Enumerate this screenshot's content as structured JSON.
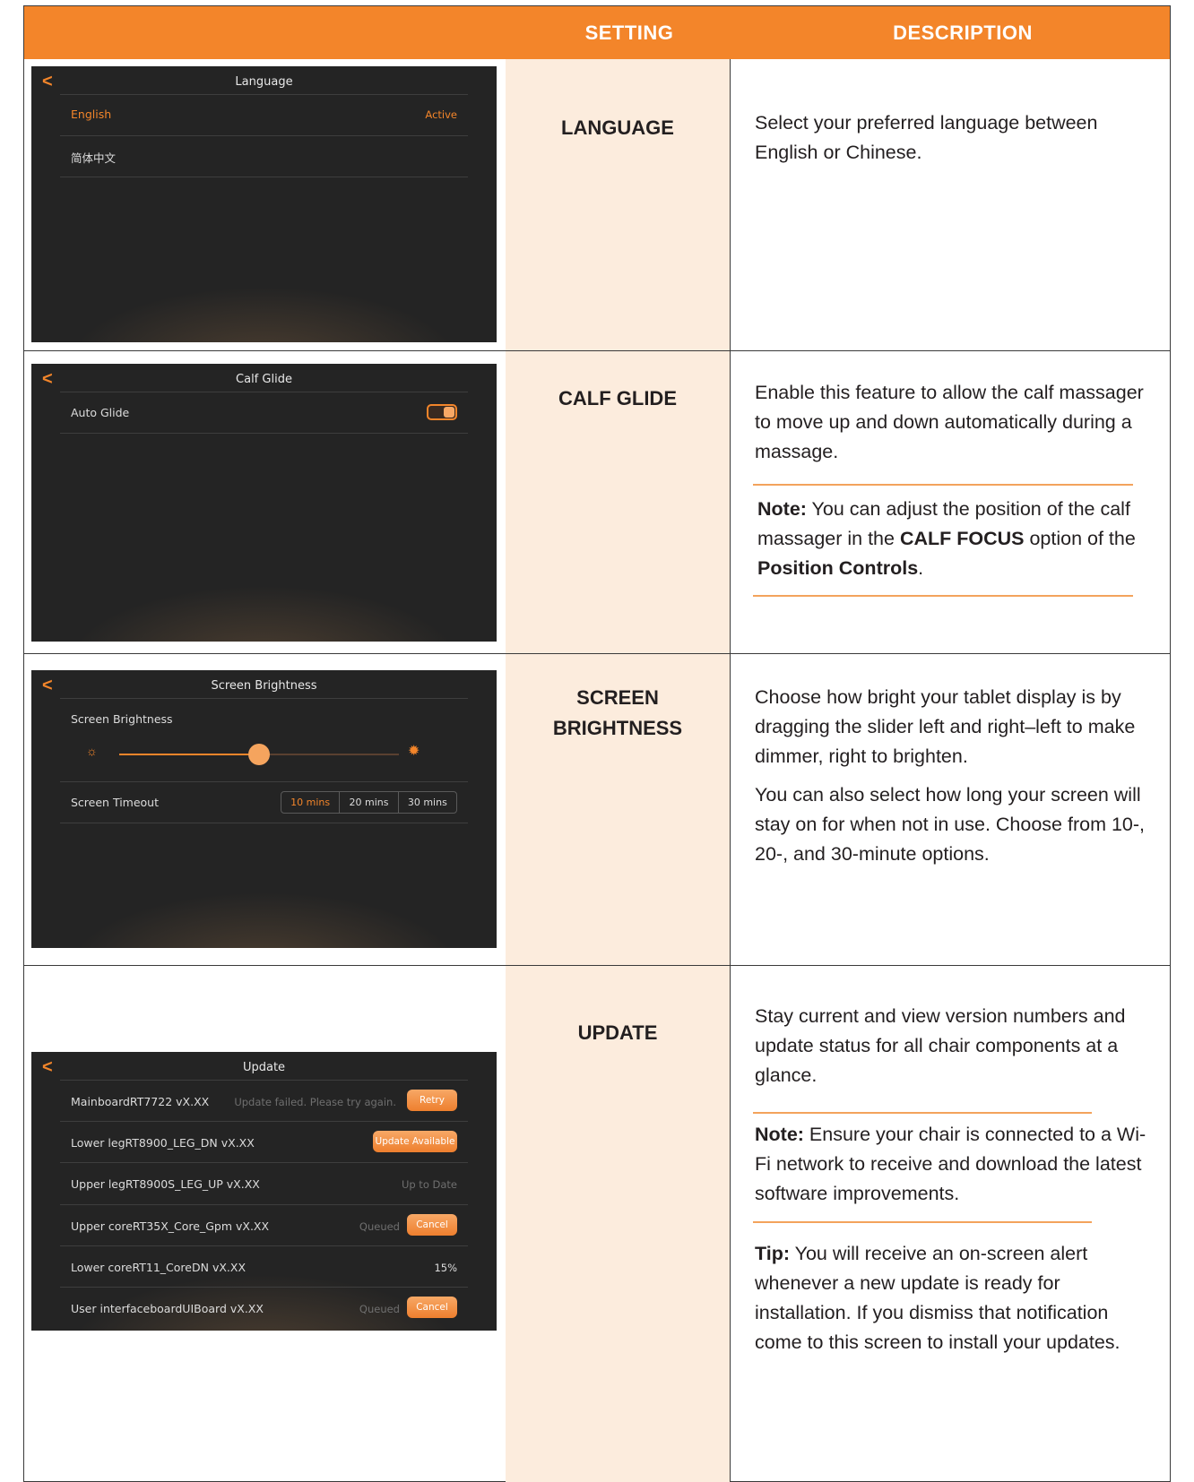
{
  "header": {
    "setting": "SETTING",
    "description": "DESCRIPTION"
  },
  "rows": {
    "language": {
      "setting": "LANGUAGE",
      "screen": {
        "title": "Language",
        "items": [
          {
            "label": "English",
            "status": "Active"
          },
          {
            "label": "简体中文"
          }
        ]
      },
      "desc": [
        "Select your preferred language between English or Chinese."
      ]
    },
    "calf": {
      "setting": "CALF GLIDE",
      "screen": {
        "title": "Calf Glide",
        "item": "Auto Glide",
        "toggle_on": true
      },
      "desc": [
        "Enable this feature to allow the calf massager to move up and down automatically during a massage."
      ],
      "note": {
        "label": "Note:",
        "t1": " You can adjust the position of the calf massager in the ",
        "b1": "CALF FOCUS",
        "t2": " option of the ",
        "b2": "Position Controls",
        "t3": "."
      }
    },
    "brightness": {
      "setting_line1": "SCREEN",
      "setting_line2": "BRIGHTNESS",
      "screen": {
        "title": "Screen Brightness",
        "brightness_label": "Screen Brightness",
        "brightness_level": 0.5,
        "timeout_label": "Screen Timeout",
        "options": [
          "10 mins",
          "20 mins",
          "30 mins"
        ],
        "selected": "10 mins"
      },
      "desc": [
        "Choose how bright your tablet display is by dragging the slider left and right–left to make dimmer, right to brighten.",
        "You can also select how long your screen will stay on for when not in use. Choose from 10-, 20-, and 30-minute options."
      ]
    },
    "update": {
      "setting": "UPDATE",
      "screen": {
        "title": "Update",
        "items": [
          {
            "label": "MainboardRT7722 vX.XX",
            "status": "Update failed. Please try again.",
            "button": "Retry"
          },
          {
            "label": "Lower legRT8900_LEG_DN vX.XX",
            "button": "Update Available"
          },
          {
            "label": "Upper legRT8900S_LEG_UP vX.XX",
            "status": "Up to Date"
          },
          {
            "label": "Upper coreRT35X_Core_Gpm vX.XX",
            "status": "Queued",
            "button": "Cancel"
          },
          {
            "label": "Lower coreRT11_CoreDN vX.XX",
            "status": "15%"
          },
          {
            "label": "User interfaceboardUIBoard vX.XX",
            "status": "Queued",
            "button": "Cancel"
          }
        ]
      },
      "desc": [
        "Stay current and view version numbers and update status for all chair components at a glance."
      ],
      "note": {
        "label": "Note:",
        "text": " Ensure your chair is connected to a Wi-Fi network to receive and download the latest software improvements."
      },
      "tip": {
        "label": "Tip:",
        "text": " You will receive an on-screen alert whenever a new update is ready for installation. If you dismiss that notification come to this screen to install your updates."
      }
    }
  }
}
